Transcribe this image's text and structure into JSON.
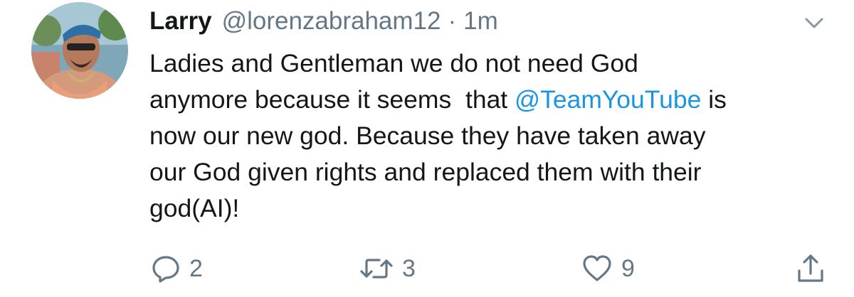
{
  "tweet": {
    "display_name": "Larry",
    "handle": "@lorenzabraham12",
    "separator": "·",
    "timestamp": "1m",
    "body": {
      "line1": "Ladies and Gentleman we do not need God",
      "line2_prefix": "anymore because it seems  that ",
      "line2_mention": "@TeamYouTube",
      "line2_suffix": " is",
      "line3": "now our new god. Because they have taken away",
      "line4": "our God given rights and replaced them with their",
      "line5": "god(AI)!"
    },
    "actions": {
      "reply_count": "2",
      "retweet_count": "3",
      "like_count": "9"
    }
  },
  "icons": {
    "avatar": "profile-photo",
    "caret": "chevron-down-icon",
    "reply": "reply-icon",
    "retweet": "retweet-icon",
    "like": "heart-icon",
    "share": "share-icon"
  },
  "colors": {
    "text": "#14171a",
    "secondary": "#657786",
    "link": "#1b95e0",
    "background": "#ffffff"
  }
}
